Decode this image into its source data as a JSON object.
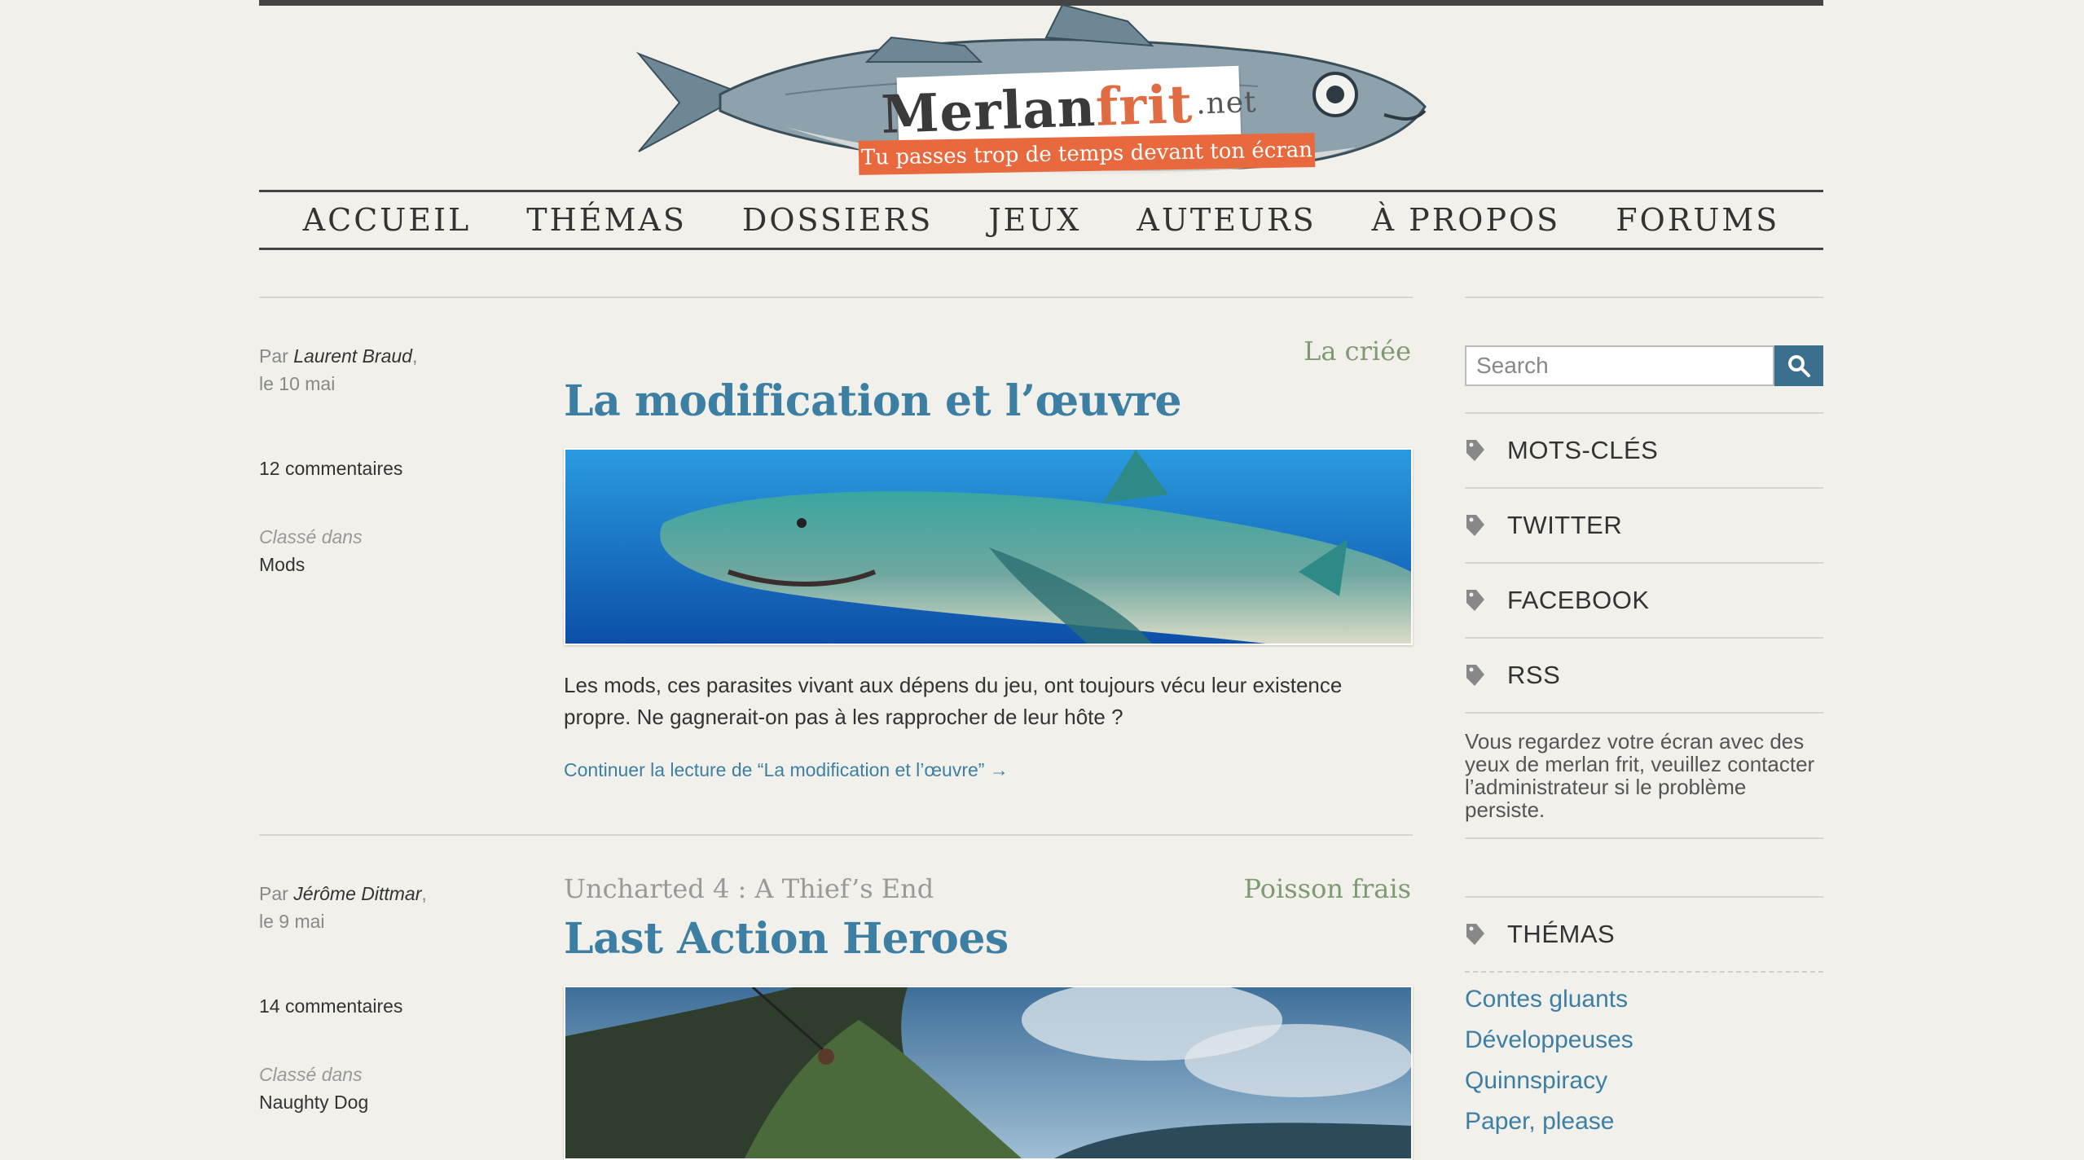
{
  "site": {
    "logo_word1": "Merlan",
    "logo_word2": "frit",
    "logo_word3": ".net",
    "tagline": "Tu passes trop de temps devant ton écran"
  },
  "nav": [
    "ACCUEIL",
    "THÉMAS",
    "DOSSIERS",
    "JEUX",
    "AUTEURS",
    "À PROPOS",
    "FORUMS"
  ],
  "posts": [
    {
      "by_label": "Par",
      "author": "Laurent Braud",
      "date": "le 10 mai",
      "comments": "12 commentaires",
      "category_label": "Classé dans",
      "category": "Mods",
      "kicker": "La criée",
      "series": "",
      "title": "La modification et l’œuvre",
      "excerpt": "Les mods, ces parasites vivant aux dépens du jeu, ont toujours vécu leur existence propre. Ne gagnerait-on pas à les rapprocher de leur hôte ?",
      "more": "Continuer la lecture de “La modification et l’œuvre” →"
    },
    {
      "by_label": "Par",
      "author": "Jérôme Dittmar",
      "date": "le 9 mai",
      "comments": "14 commentaires",
      "category_label": "Classé dans",
      "category": "Naughty Dog",
      "kicker": "Poisson frais",
      "series": "Uncharted 4 : A Thief’s End",
      "title": "Last Action Heroes"
    }
  ],
  "sidebar": {
    "search_placeholder": "Search",
    "items": [
      "MOTS-CLÉS",
      "TWITTER",
      "FACEBOOK",
      "RSS"
    ],
    "note": "Vous regardez votre écran avec des yeux de merlan frit, veuillez contacter l’administrateur si le problème persiste.",
    "themas_title": "THÉMAS",
    "themas_links": [
      "Contes gluants",
      "Développeuses",
      "Quinnspiracy",
      "Paper, please"
    ]
  },
  "colors": {
    "accent_blue": "#3d7fa3",
    "kicker_green": "#7d9a72",
    "ribbon_orange": "#e9693e",
    "background": "#f1f0ea"
  }
}
